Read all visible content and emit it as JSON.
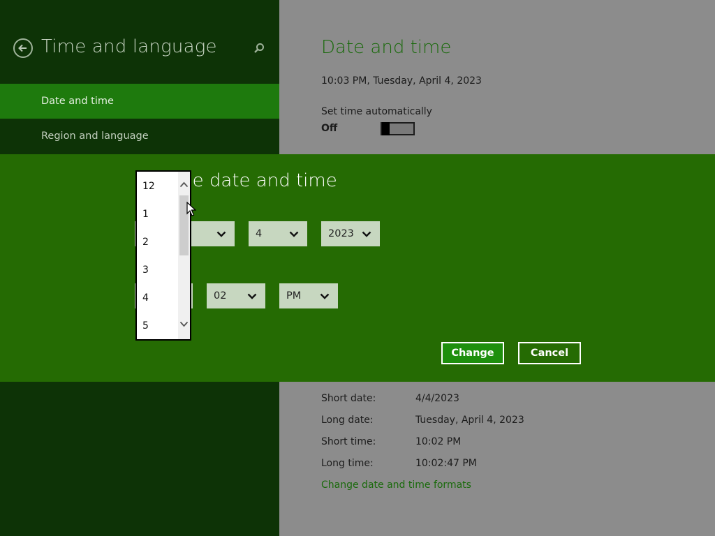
{
  "sidebar": {
    "title": "Time and language",
    "items": [
      {
        "label": "Date and time",
        "selected": true
      },
      {
        "label": "Region and language",
        "selected": false
      }
    ],
    "back_icon": "back-arrow-icon",
    "search_icon": "search-icon"
  },
  "main": {
    "title": "Date and time",
    "current_datetime": "10:03 PM, Tuesday, April 4, 2023",
    "set_auto_label": "Set time automatically",
    "set_auto_state": "Off",
    "formats": [
      {
        "key": "Short date:",
        "value": "4/4/2023"
      },
      {
        "key": "Long date:",
        "value": "Tuesday, April 4, 2023"
      },
      {
        "key": "Short time:",
        "value": "10:02 PM"
      },
      {
        "key": "Long time:",
        "value": "10:02:47 PM"
      }
    ],
    "change_formats_link": "Change date and time formats"
  },
  "dialog": {
    "title_visible": "e date and time",
    "date": {
      "day": "4",
      "year": "2023"
    },
    "time": {
      "minute": "02",
      "ampm": "PM"
    },
    "change_button": "Change",
    "cancel_button": "Cancel",
    "hour_options": [
      "12",
      "1",
      "2",
      "3",
      "4",
      "5"
    ]
  },
  "colors": {
    "sidebar_bg": "#0d3306",
    "nav_selected": "#1e7a0d",
    "dialog_bg": "#256b03",
    "accent_text": "#1a6a0c",
    "main_bg_dimmed": "#8c8c8c"
  }
}
